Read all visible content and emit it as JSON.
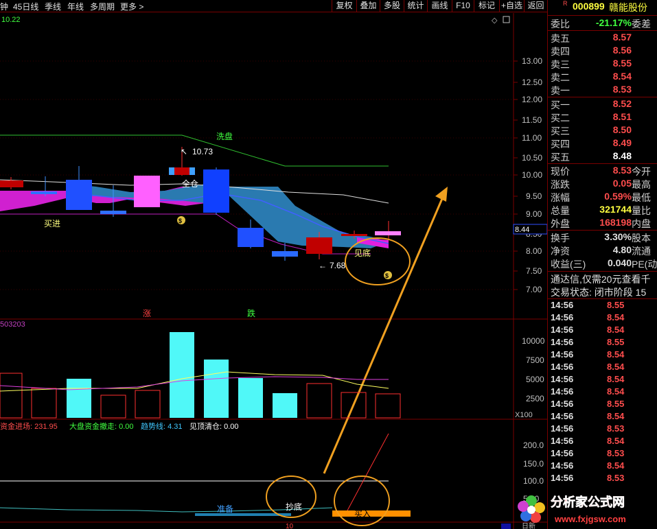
{
  "toolbar": {
    "left_items": [
      "钟",
      "45日线",
      "季线",
      "年线",
      "多周期",
      "更多 >"
    ],
    "buttons": [
      "复权",
      "叠加",
      "多股",
      "统计",
      "画线",
      "F10",
      "标记",
      "+自选",
      "返回"
    ]
  },
  "main_chart": {
    "top_value": "10.22",
    "price_axis": [
      "13.00",
      "12.50",
      "12.00",
      "11.50",
      "11.00",
      "10.50",
      "10.00",
      "9.50",
      "9.00",
      "8.50",
      "8.00",
      "7.50",
      "7.00"
    ],
    "current_price_marker": "8.44",
    "annotations": {
      "xipan": "洗盘",
      "high": "10.73",
      "quancang": "全仓",
      "maijin": "买进",
      "jiandi": "见底",
      "low": "7.68",
      "zhang": "涨",
      "die": "跌"
    }
  },
  "volume_chart": {
    "label": "503203",
    "axis": [
      "10000",
      "7500",
      "5000",
      "2500"
    ],
    "multiplier": "X100"
  },
  "indicator_chart": {
    "legend": [
      {
        "label": "资金进场: 231.95",
        "color": "#ff4d4d"
      },
      {
        "label": "大盘资金撤走: 0.00",
        "color": "#40ff40"
      },
      {
        "label": "趋势线: 4.31",
        "color": "#40c8ff"
      },
      {
        "label": "见顶清仓: 0.00",
        "color": "#ffffff"
      }
    ],
    "axis": [
      "200.0",
      "150.0",
      "100.0",
      "50.0"
    ],
    "labels": {
      "zhunbei": "准备",
      "chaodi": "抄底",
      "mairu": "买入"
    },
    "bottom_value": "10",
    "bottom_right": "日新"
  },
  "panel": {
    "tag": "R",
    "code": "000899",
    "name": "赣能股份",
    "weibi_label": "委比",
    "weibi_value": "-21.17%",
    "weicha_label": "委差",
    "asks": [
      {
        "label": "卖五",
        "price": "8.57"
      },
      {
        "label": "卖四",
        "price": "8.56"
      },
      {
        "label": "卖三",
        "price": "8.55"
      },
      {
        "label": "卖二",
        "price": "8.54"
      },
      {
        "label": "卖一",
        "price": "8.53"
      }
    ],
    "bids": [
      {
        "label": "买一",
        "price": "8.52"
      },
      {
        "label": "买二",
        "price": "8.51"
      },
      {
        "label": "买三",
        "price": "8.50"
      },
      {
        "label": "买四",
        "price": "8.49"
      },
      {
        "label": "买五",
        "price": "8.48"
      }
    ],
    "stats": [
      {
        "label": "现价",
        "value": "8.53",
        "tail": "今开",
        "color": "#ff4d4d"
      },
      {
        "label": "涨跌",
        "value": "0.05",
        "tail": "最高",
        "color": "#ff4d4d"
      },
      {
        "label": "涨幅",
        "value": "0.59%",
        "tail": "最低",
        "color": "#ff4d4d"
      },
      {
        "label": "总量",
        "value": "321744",
        "tail": "量比",
        "color": "#ffff40"
      },
      {
        "label": "外盘",
        "value": "168198",
        "tail": "内盘",
        "color": "#ff4d4d"
      }
    ],
    "stats2": [
      {
        "label": "换手",
        "value": "3.30%",
        "tail": "股本",
        "color": "#e0e0e0"
      },
      {
        "label": "净资",
        "value": "4.80",
        "tail": "流通",
        "color": "#e0e0e0"
      },
      {
        "label": "收益(三)",
        "value": "0.040",
        "tail": "PE(动",
        "color": "#e0e0e0"
      }
    ],
    "promo": "通达信,仅需20元查看千",
    "trade_status": "交易状态: 闭市阶段 15",
    "ticks": [
      {
        "time": "14:56",
        "price": "8.55"
      },
      {
        "time": "14:56",
        "price": "8.54"
      },
      {
        "time": "14:56",
        "price": "8.54"
      },
      {
        "time": "14:56",
        "price": "8.55"
      },
      {
        "time": "14:56",
        "price": "8.54"
      },
      {
        "time": "14:56",
        "price": "8.54"
      },
      {
        "time": "14:56",
        "price": "8.54"
      },
      {
        "time": "14:56",
        "price": "8.54"
      },
      {
        "time": "14:56",
        "price": "8.55"
      },
      {
        "time": "14:56",
        "price": "8.54"
      },
      {
        "time": "14:56",
        "price": "8.53"
      },
      {
        "time": "14:56",
        "price": "8.54"
      },
      {
        "time": "14:56",
        "price": "8.53"
      },
      {
        "time": "14:56",
        "price": "8.54"
      },
      {
        "time": "14:56",
        "price": "8.53"
      }
    ]
  },
  "watermark": {
    "title": "分析家公式网",
    "url": "www.fxjgsw.com"
  }
}
